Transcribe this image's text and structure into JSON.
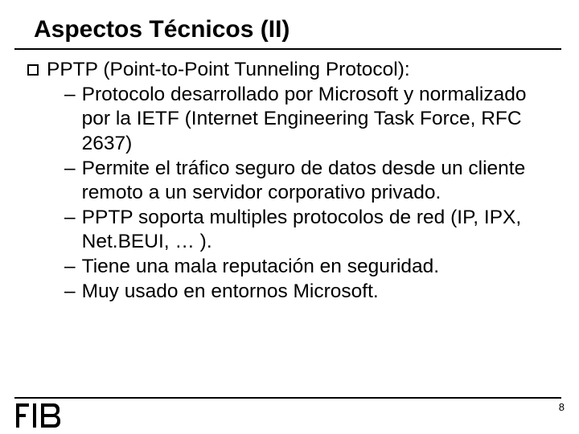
{
  "title": "Aspectos Técnicos (II)",
  "main": {
    "heading": "PPTP (Point-to-Point Tunneling Protocol):",
    "items": [
      "Protocolo desarrollado por Microsoft y normalizado por la IETF (Internet Engineering Task Force, RFC 2637)",
      "Permite el tráfico seguro de datos desde un cliente remoto a un servidor corporativo privado.",
      "PPTP soporta multiples protocolos de red (IP, IPX, Net.BEUI, … ).",
      "Tiene una mala reputación en seguridad.",
      "Muy usado en entornos Microsoft."
    ]
  },
  "page_number": "8",
  "logo_text": "FIB"
}
